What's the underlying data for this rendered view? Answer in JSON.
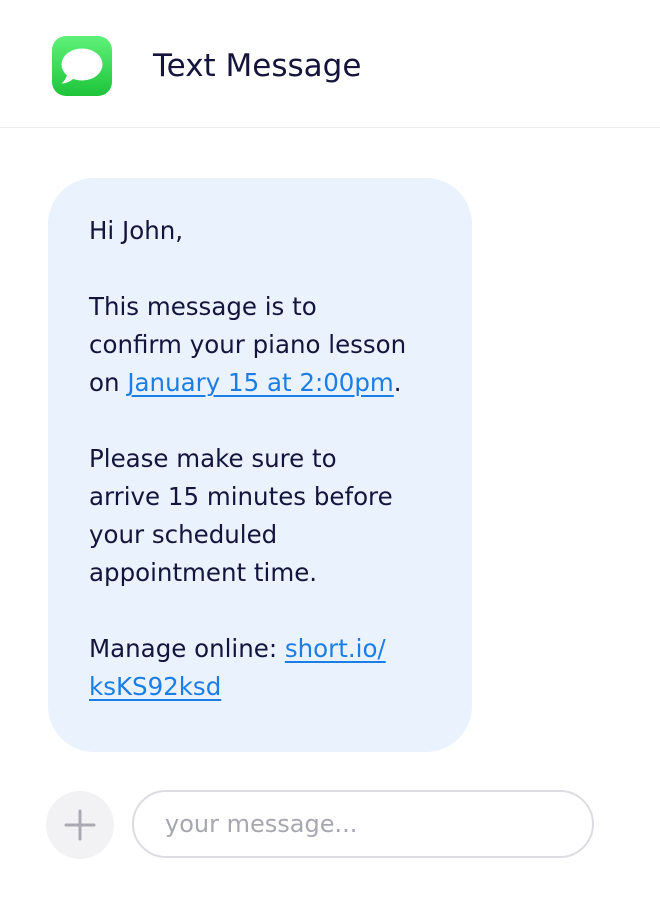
{
  "header": {
    "app_icon": "messages-bubble-icon",
    "title": "Text Message"
  },
  "message": {
    "greeting": "Hi John,",
    "paragraph1": {
      "line1": "This message is to",
      "line2": "confirm your piano lesson",
      "line3_prefix": "on ",
      "date_link": "January 15 at 2:00pm",
      "line3_suffix": "."
    },
    "paragraph2": {
      "line1": "Please make sure to",
      "line2": "arrive 15 minutes before",
      "line3": "your scheduled",
      "line4": "appointment time."
    },
    "manage": {
      "prefix": "Manage online: ",
      "link_part1": "short.io/",
      "link_part2": "ksKS92ksd"
    }
  },
  "composer": {
    "add_icon": "plus-icon",
    "placeholder": "your message...",
    "value": ""
  },
  "colors": {
    "bubble_background": "#e9f2fd",
    "link": "#1b7ee6",
    "text": "#14143c",
    "app_icon_green": "#1ec43a"
  }
}
